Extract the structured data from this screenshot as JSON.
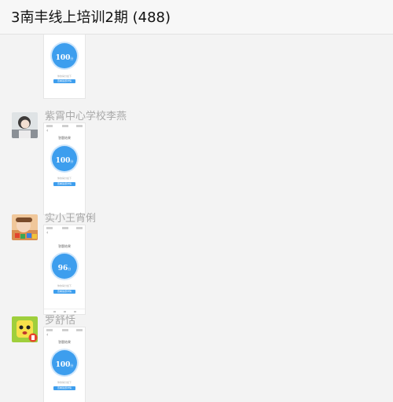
{
  "header": {
    "title": "3南丰线上培训2期 (488)"
  },
  "messages": [
    {
      "sender": "",
      "screenshot": {
        "page_title": "",
        "score": "100",
        "unit": "分",
        "caption": "你的得分如下",
        "button_label": "查看答题详情"
      }
    },
    {
      "sender": "紫霄中心学校李燕",
      "avatar_icon": "girl-photo-avatar",
      "screenshot": {
        "page_title": "答题结果",
        "score": "100",
        "unit": "分",
        "caption": "你的得分如下",
        "button_label": "查看答题详情"
      }
    },
    {
      "sender": "实小王宵俐",
      "avatar_icon": "child-photo-avatar",
      "screenshot": {
        "page_title": "答题结果",
        "score": "96",
        "unit": "分",
        "caption": "你的得分如下",
        "button_label": "查看答题详情"
      }
    },
    {
      "sender": "罗舒恬",
      "avatar_icon": "cartoon-character-avatar",
      "screenshot": {
        "page_title": "答题结果",
        "score": "100",
        "unit": "分",
        "caption": "你的得分如下",
        "button_label": "查看答题详情"
      }
    }
  ],
  "colors": {
    "accent": "#3d9eee",
    "background": "#f3f3f3",
    "sender_name": "#a9a9a9"
  }
}
